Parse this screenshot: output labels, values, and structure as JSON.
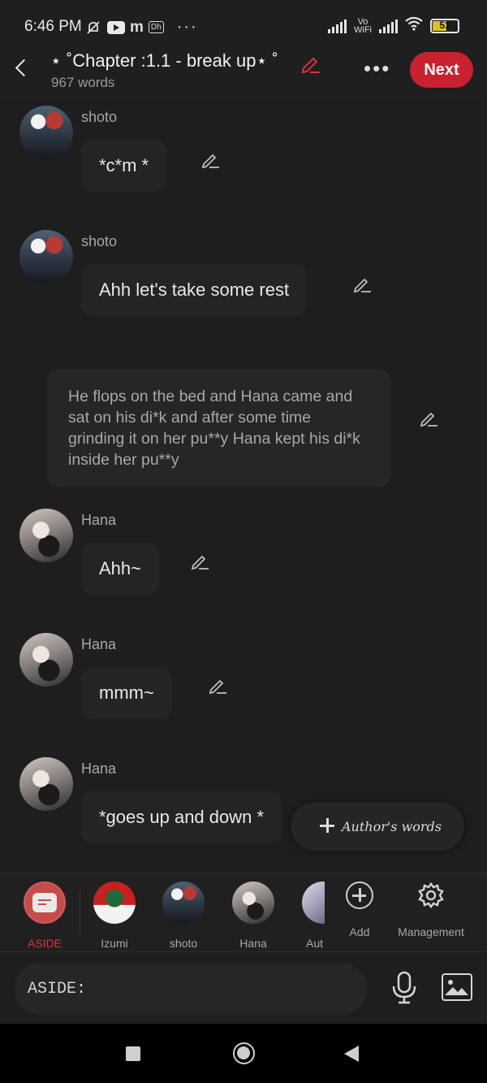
{
  "status_bar": {
    "time": "6:46 PM",
    "app_icons": [
      "mute-bell-icon",
      "youtube-icon",
      "m-icon",
      "dh-icon"
    ],
    "dh_label": "Dh",
    "m_label": "m",
    "more_dots": "···",
    "vowifi": "Vo WiFi",
    "battery_level": "51"
  },
  "header": {
    "title": "⋆ ˚Chapter :1.1 - break up⋆ ˚",
    "word_count": "967 words",
    "next_label": "Next",
    "accent_color": "#c9212f"
  },
  "messages": [
    {
      "type": "dialogue",
      "character": "shoto",
      "name": "shoto",
      "text": "*c*m *"
    },
    {
      "type": "dialogue",
      "character": "shoto",
      "name": "shoto",
      "text": "Ahh let's take some rest"
    },
    {
      "type": "narration",
      "text": "He flops on the bed and Hana came and sat on his di*k and after some time grinding it on her pu**y Hana kept his di*k inside her pu**y"
    },
    {
      "type": "dialogue",
      "character": "hana",
      "name": "Hana",
      "text": "Ahh~"
    },
    {
      "type": "dialogue",
      "character": "hana",
      "name": "Hana",
      "text": "mmm~"
    },
    {
      "type": "dialogue",
      "character": "hana",
      "name": "Hana",
      "text": "*goes up and down *"
    }
  ],
  "authors_words_label": "Author's words",
  "character_bar": {
    "aside_label": "ASIDE",
    "characters": [
      "Izumi",
      "shoto",
      "Hana",
      "Aut"
    ],
    "add_label": "Add",
    "management_label": "Management"
  },
  "input": {
    "placeholder": "ASIDE:"
  }
}
